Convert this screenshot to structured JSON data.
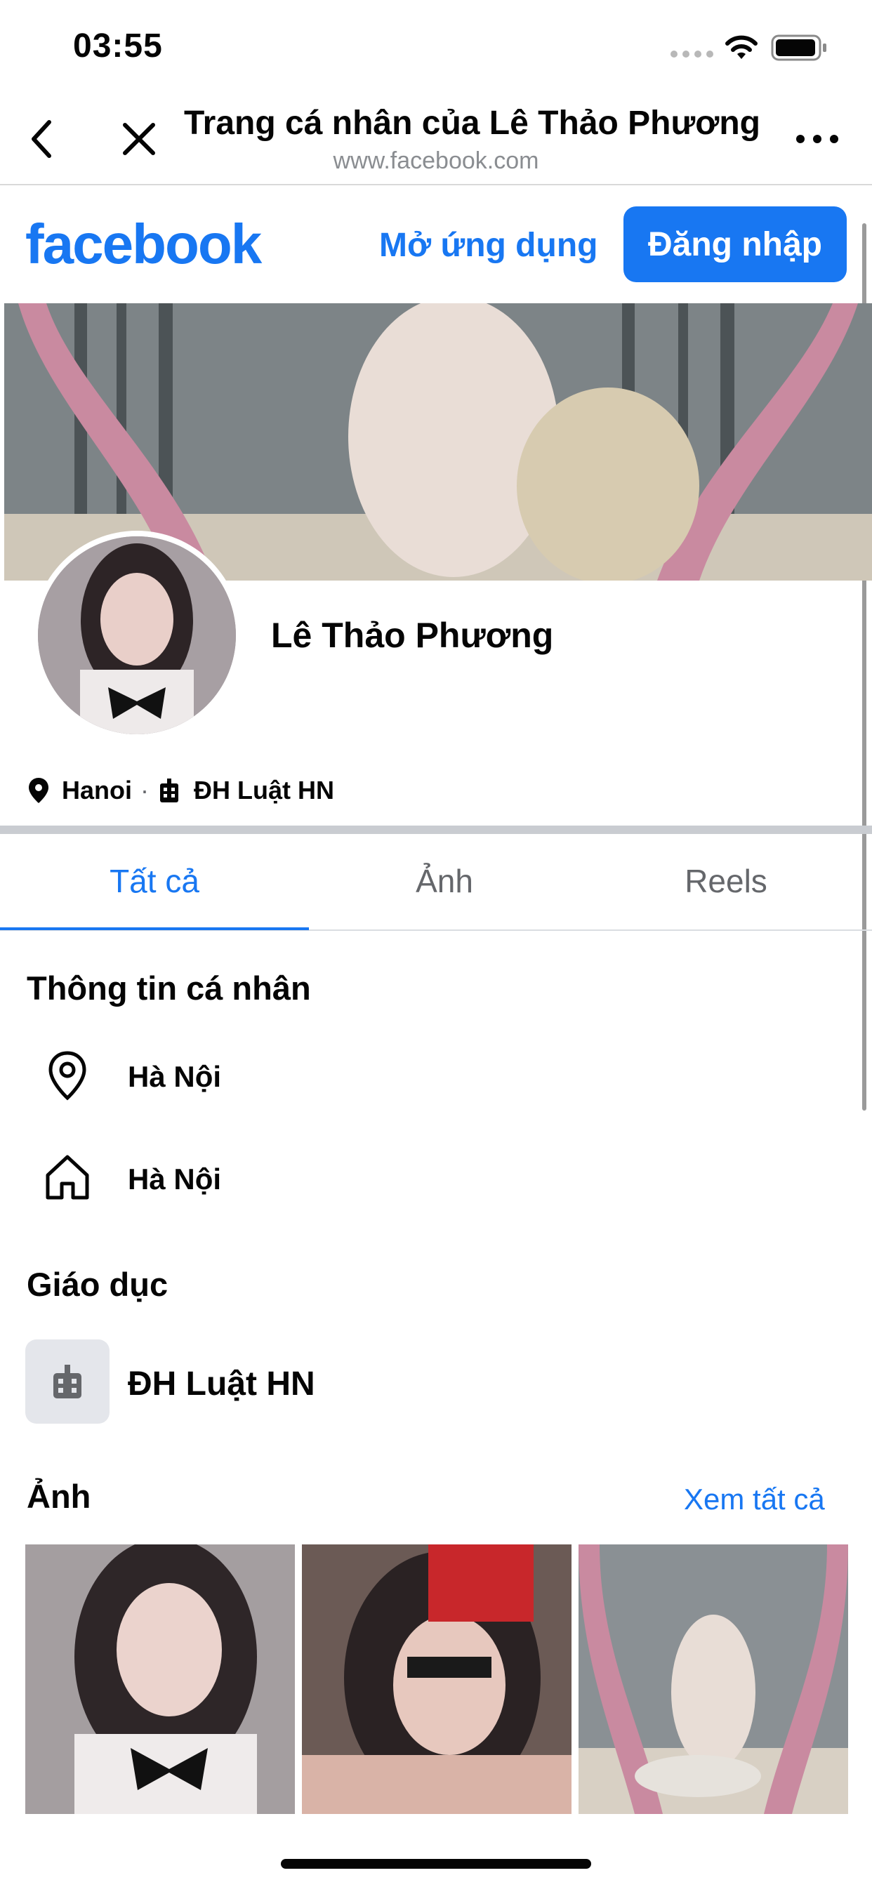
{
  "status_bar": {
    "time": "03:55"
  },
  "browser": {
    "title": "Trang cá nhân của Lê Thảo Phương",
    "url": "www.facebook.com"
  },
  "fb_header": {
    "logo": "facebook",
    "open_app_label": "Mở ứng dụng",
    "login_label": "Đăng nhập"
  },
  "profile": {
    "name": "Lê Thảo Phương",
    "city": "Hanoi",
    "school": "ĐH Luật HN"
  },
  "tabs": [
    {
      "label": "Tất cả",
      "active": true
    },
    {
      "label": "Ảnh",
      "active": false
    },
    {
      "label": "Reels",
      "active": false
    }
  ],
  "personal_info": {
    "heading": "Thông tin cá nhân",
    "current_city": "Hà Nội",
    "hometown": "Hà Nội"
  },
  "education": {
    "heading": "Giáo dục",
    "school": "ĐH Luật HN"
  },
  "photos": {
    "heading": "Ảnh",
    "see_all_label": "Xem tất cả"
  },
  "colors": {
    "brand": "#1877f2",
    "secondary_text": "#65676b",
    "divider": "#c9ccd1"
  },
  "icons": [
    "back-icon",
    "close-icon",
    "more-icon",
    "wifi-icon",
    "battery-icon",
    "location-pin-icon",
    "building-icon",
    "home-icon",
    "school-icon"
  ]
}
